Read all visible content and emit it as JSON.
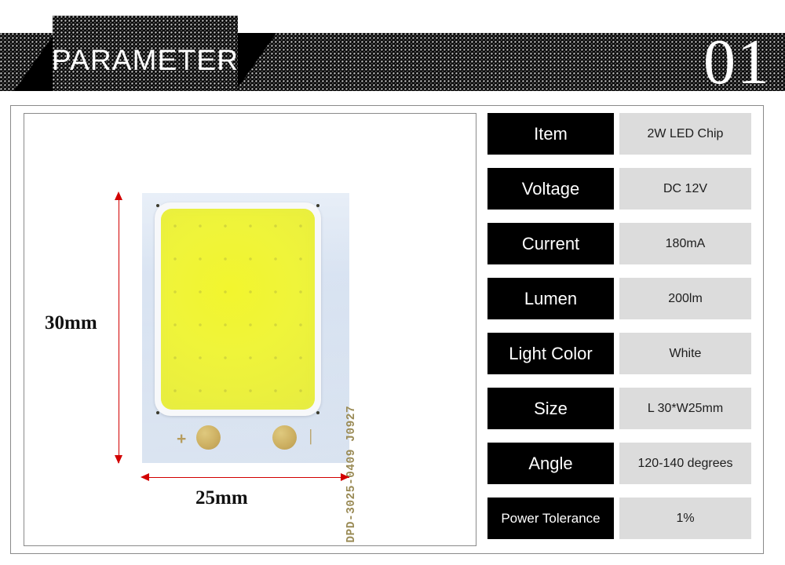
{
  "header": {
    "title": "PARAMETER",
    "number": "01",
    "accent_color": "#000000",
    "text_color": "#ffffff"
  },
  "product_image": {
    "caption_alt": "2W COB LED chip on white ceramic substrate",
    "part_number": "DPD-3025-0409 J0927",
    "polarity_positive": "+",
    "polarity_negative": "|",
    "dimensions": {
      "height_label": "30mm",
      "width_label": "25mm",
      "annotation_color": "#d20000"
    },
    "colors": {
      "substrate": "#cfdcee",
      "phosphor": "#eff43a",
      "pad": "#cdb062"
    }
  },
  "spec_table": {
    "label_bg": "#000000",
    "value_bg": "#dcdcdc",
    "rows": [
      {
        "label": "Item",
        "value": "2W LED Chip"
      },
      {
        "label": "Voltage",
        "value": "DC 12V"
      },
      {
        "label": "Current",
        "value": "180mA"
      },
      {
        "label": "Lumen",
        "value": "200lm"
      },
      {
        "label": "Light Color",
        "value": "White"
      },
      {
        "label": "Size",
        "value": "L 30*W25mm"
      },
      {
        "label": "Angle",
        "value": "120-140 degrees"
      },
      {
        "label": "Power Tolerance",
        "value": "1%"
      }
    ]
  }
}
